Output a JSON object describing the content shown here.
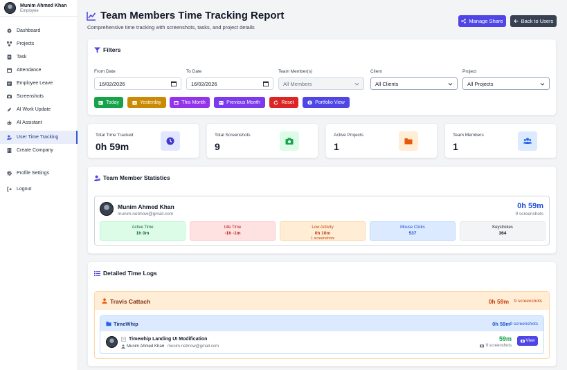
{
  "user": {
    "name": "Munim Ahmed Khan",
    "role": "Employee"
  },
  "sidebar": {
    "items": [
      {
        "label": "Dashboard",
        "icon": "dashboard-icon"
      },
      {
        "label": "Projects",
        "icon": "projects-icon"
      },
      {
        "label": "Task",
        "icon": "task-icon"
      },
      {
        "label": "Attendance",
        "icon": "attendance-icon"
      },
      {
        "label": "Employee Leave",
        "icon": "leave-icon"
      },
      {
        "label": "Screenshots",
        "icon": "camera-icon"
      },
      {
        "label": "AI Work Update",
        "icon": "pen-icon"
      },
      {
        "label": "AI Assistant",
        "icon": "robot-icon"
      },
      {
        "label": "User Time Tracking",
        "icon": "user-clock-icon",
        "active": true
      },
      {
        "label": "Create Company",
        "icon": "building-icon"
      },
      {
        "label": "Profile Settings",
        "icon": "gear-icon"
      },
      {
        "label": "Logout",
        "icon": "logout-icon"
      }
    ]
  },
  "header": {
    "title": "Team Members Time Tracking Report",
    "subtitle": "Comprehensive time tracking with screenshots, tasks, and project details",
    "manage_share": "Manage Share",
    "back": "Back to Users"
  },
  "filters": {
    "title": "Filters",
    "from_label": "From Date",
    "from_value": "16/02/2026",
    "to_label": "To Date",
    "to_value": "16/02/2026",
    "member_label": "Team Member(s)",
    "member_value": "All Members",
    "client_label": "Client",
    "client_value": "All Clients",
    "project_label": "Project",
    "project_value": "All Projects",
    "buttons": [
      "Today",
      "Yesterday",
      "This Month",
      "Previous Month",
      "Reset",
      "Portfolio View"
    ]
  },
  "stats": [
    {
      "label": "Total Time Tracked",
      "value": "0h 59m",
      "icon": "clock-icon"
    },
    {
      "label": "Total Screenshots",
      "value": "9",
      "icon": "camera-icon"
    },
    {
      "label": "Active Projects",
      "value": "1",
      "icon": "folder-icon"
    },
    {
      "label": "Team Members",
      "value": "1",
      "icon": "users-icon"
    }
  ],
  "team_stats": {
    "title": "Team Member Statistics",
    "member": {
      "name": "Munim Ahmed Khan",
      "email": "munim.netmow@gmail.com",
      "total": "0h 59m",
      "screenshots": "9 screenshots",
      "metrics": [
        {
          "label": "Active Time",
          "value": "1h 0m",
          "sub": ""
        },
        {
          "label": "Idle Time",
          "value": "-1h -1m",
          "sub": ""
        },
        {
          "label": "Low Activity",
          "value": "0h 10m",
          "sub": "1 screenshots"
        },
        {
          "label": "Mouse Clicks",
          "value": "537",
          "sub": ""
        },
        {
          "label": "Keystrokes",
          "value": "364",
          "sub": ""
        }
      ]
    }
  },
  "logs": {
    "title": "Detailed Time Logs",
    "client": {
      "name": "Travis Cattach",
      "total": "0h 59m",
      "screenshots": "9 screenshots"
    },
    "project": {
      "name": "TimeWhip",
      "total": "0h 59m",
      "screenshots": "9 screenshots"
    },
    "task": {
      "name": "Timewhip Landing UI Modification",
      "user": "Munim Ahmed Khan",
      "email": "munim.netmow@gmail.com",
      "duration": "59m",
      "screenshots": "9 screenshots",
      "view": "View"
    }
  },
  "colors": {
    "primary": "#4f46e5",
    "today": "#16a34a",
    "yesterday": "#ca8a04",
    "this_month": "#9333ea",
    "previous_month": "#7c3aed",
    "reset": "#dc2626",
    "back_button": "#374151",
    "client_accent": "#ea580c"
  }
}
